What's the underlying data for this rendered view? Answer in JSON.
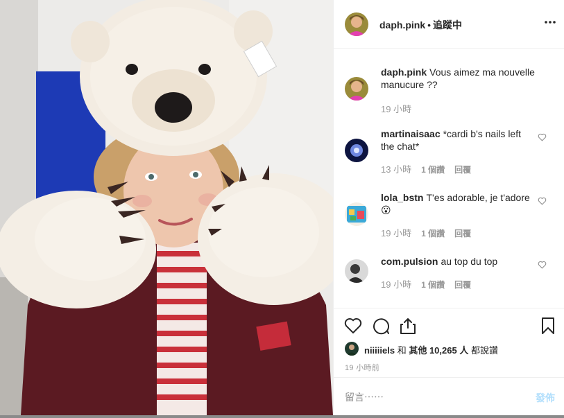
{
  "post": {
    "username": "daph.pink",
    "separator": "•",
    "follow_status": "追蹤中",
    "more_label": "•••"
  },
  "comments": [
    {
      "user": "daph.pink",
      "text": "Vous aimez ma nouvelle manucure ??",
      "time": "19 小時",
      "likes": "",
      "reply": ""
    },
    {
      "user": "martinaisaac",
      "text": "*cardi b's nails left the chat*",
      "time": "13 小時",
      "likes": "1 個讚",
      "reply": "回覆"
    },
    {
      "user": "lola_bstn",
      "text": "T'es adorable, je t'adore 😮",
      "time": "19 小時",
      "likes": "1 個讚",
      "reply": "回覆"
    },
    {
      "user": "com.pulsion",
      "text": "au top du top",
      "time": "19 小時",
      "likes": "1 個讚",
      "reply": "回覆"
    }
  ],
  "likes": {
    "liker": "niiiiiels",
    "conjunction": "和",
    "others_label": "其他 10,265 人",
    "suffix": "都說讚"
  },
  "time_ago": "19 小時前",
  "add_comment": {
    "placeholder": "留言⋯⋯",
    "post_label": "發佈"
  },
  "colors": {
    "text": "#262626",
    "muted": "#999999",
    "divider": "#efefef",
    "post_button_disabled": "#b2dffc"
  },
  "icons": [
    "heart-icon",
    "comment-icon",
    "share-icon",
    "bookmark-icon",
    "more-icon"
  ]
}
